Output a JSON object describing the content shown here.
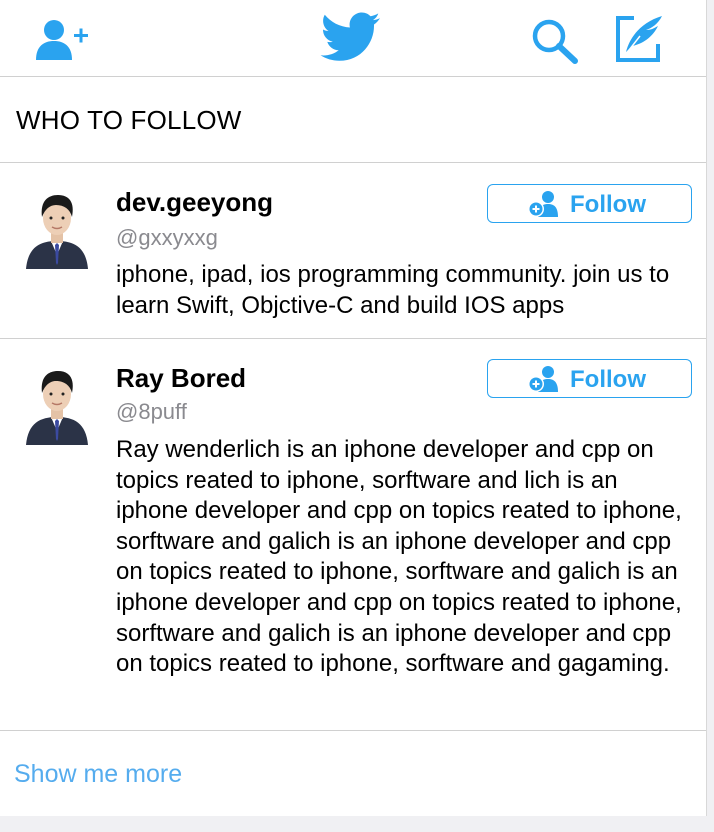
{
  "navbar": {
    "icons": [
      "add-user-icon",
      "twitter-bird-icon",
      "search-icon",
      "compose-icon"
    ]
  },
  "section": {
    "title": "WHO TO FOLLOW"
  },
  "suggestions": [
    {
      "name": "dev.geeyong",
      "handle": "@gxxyxxg",
      "bio": "iphone, ipad, ios programming community. join us to learn Swift, Objctive-C and build IOS apps",
      "follow_label": "Follow"
    },
    {
      "name": "Ray Bored",
      "handle": "@8puff",
      "bio": "Ray wenderlich is an iphone developer and cpp on topics reated to iphone, sorftware and lich is an iphone developer and cpp on topics reated to iphone, sorftware and galich is an iphone developer and cpp on topics reated to iphone, sorftware and galich is an iphone developer and cpp on topics reated to iphone, sorftware and galich is an iphone developer and cpp on topics reated to iphone, sorftware and gagaming.",
      "follow_label": "Follow"
    }
  ],
  "footer": {
    "show_more": "Show me more"
  },
  "colors": {
    "accent": "#2aa3ef",
    "link": "#55acee",
    "handle": "#8a8a8f"
  }
}
